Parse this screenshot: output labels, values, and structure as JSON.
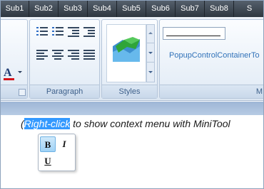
{
  "tabs": [
    "Sub1",
    "Sub2",
    "Sub3",
    "Sub4",
    "Sub5",
    "Sub6",
    "Sub7",
    "Sub8",
    "S"
  ],
  "ribbon": {
    "font_group": {
      "color_button": "A"
    },
    "paragraph_group": {
      "label": "Paragraph"
    },
    "styles_group": {
      "label": "Styles"
    },
    "popup_group": {
      "label": "M",
      "text": "PopupControlContainerTo"
    }
  },
  "document": {
    "open_paren": "(",
    "selected_text": "Right-click",
    "rest_text": " to show context menu with MiniTool"
  },
  "mini_toolbar": {
    "bold": "B",
    "italic": "I",
    "underline": "U"
  },
  "colors": {
    "font_color_bar": "#d3131a",
    "selection": "#3399ff",
    "group_label": "#3c5f8a"
  },
  "icons": [
    "bullets-icon",
    "numbering-icon",
    "decrease-indent-icon",
    "increase-indent-icon",
    "align-left-icon",
    "align-center-icon",
    "align-right-icon",
    "justify-icon",
    "styles-gallery-icon",
    "dialog-launcher-icon"
  ]
}
